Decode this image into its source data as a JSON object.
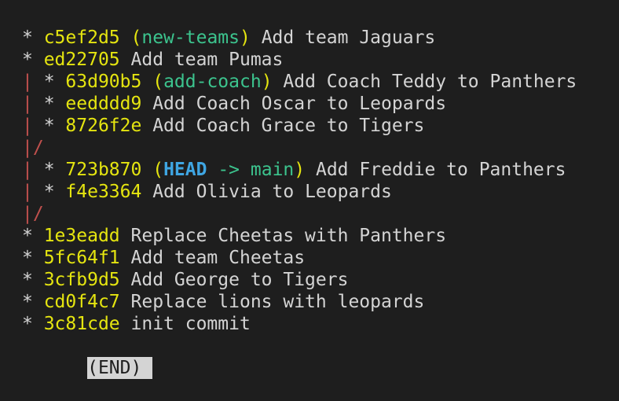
{
  "log": [
    {
      "graph": "* ",
      "hash": "c5ef2d5",
      "refs": [
        {
          "type": "branch",
          "name": "new-teams"
        }
      ],
      "message": "Add team Jaguars"
    },
    {
      "graph": "* ",
      "hash": "ed22705",
      "refs": [],
      "message": "Add team Pumas"
    },
    {
      "graph_red": "| ",
      "graph": "* ",
      "hash": "63d90b5",
      "refs": [
        {
          "type": "branch",
          "name": "add-coach"
        }
      ],
      "message": "Add Coach Teddy to Panthers"
    },
    {
      "graph_red": "| ",
      "graph": "* ",
      "hash": "eedddd9",
      "refs": [],
      "message": "Add Coach Oscar to Leopards"
    },
    {
      "graph_red": "| ",
      "graph": "* ",
      "hash": "8726f2e",
      "refs": [],
      "message": "Add Coach Grace to Tigers"
    },
    {
      "graph_red": "|/",
      "only_graph": true
    },
    {
      "graph_red": "| ",
      "graph": "* ",
      "hash": "723b870",
      "refs": [
        {
          "type": "head",
          "name": "HEAD",
          "arrow": "->",
          "target": "main"
        }
      ],
      "message": "Add Freddie to Panthers"
    },
    {
      "graph_red": "| ",
      "graph": "* ",
      "hash": "f4e3364",
      "refs": [],
      "message": "Add Olivia to Leopards"
    },
    {
      "graph_red": "|/",
      "only_graph": true
    },
    {
      "graph": "* ",
      "hash": "1e3eadd",
      "refs": [],
      "message": "Replace Cheetas with Panthers"
    },
    {
      "graph": "* ",
      "hash": "5fc64f1",
      "refs": [],
      "message": "Add team Cheetas"
    },
    {
      "graph": "* ",
      "hash": "3cfb9d5",
      "refs": [],
      "message": "Add George to Tigers"
    },
    {
      "graph": "* ",
      "hash": "cd0f4c7",
      "refs": [],
      "message": "Replace lions with leopards"
    },
    {
      "graph": "* ",
      "hash": "3c81cde",
      "refs": [],
      "message": "init commit"
    }
  ],
  "pager": {
    "end_label": "(END)"
  },
  "colors": {
    "background": "#1e1e1e",
    "text": "#d4d4d4",
    "hash": "#e5e510",
    "branch": "#3cc48e",
    "head": "#3fa6e3",
    "graph_line": "#c0504d"
  }
}
